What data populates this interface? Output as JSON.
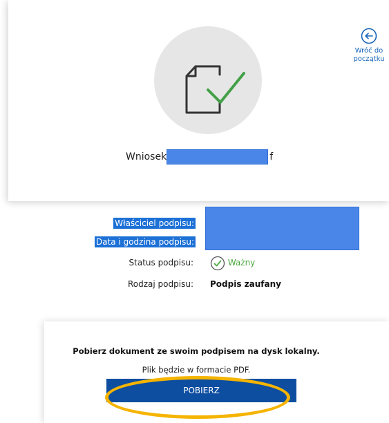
{
  "document": {
    "name_prefix": "Wniosek",
    "name_suffix": "f"
  },
  "back_button": {
    "label_line1": "Wróć do",
    "label_line2": "początku"
  },
  "signature": {
    "owner_label": "Właściciel podpisu:",
    "datetime_label": "Data i godzina podpisu:",
    "status_label": "Status podpisu:",
    "status_value": "Ważny",
    "type_label": "Rodzaj podpisu:",
    "type_value": "Podpis zaufany"
  },
  "download": {
    "title": "Pobierz dokument ze swoim podpisem na dysk lokalny.",
    "subtitle": "Plik będzie w formacie PDF.",
    "button_label": "POBIERZ"
  },
  "colors": {
    "primary": "#0d4ea0",
    "link": "#1665b8",
    "valid": "#4caa3f",
    "redaction": "#4a86e8",
    "highlight": "#f5b400"
  }
}
